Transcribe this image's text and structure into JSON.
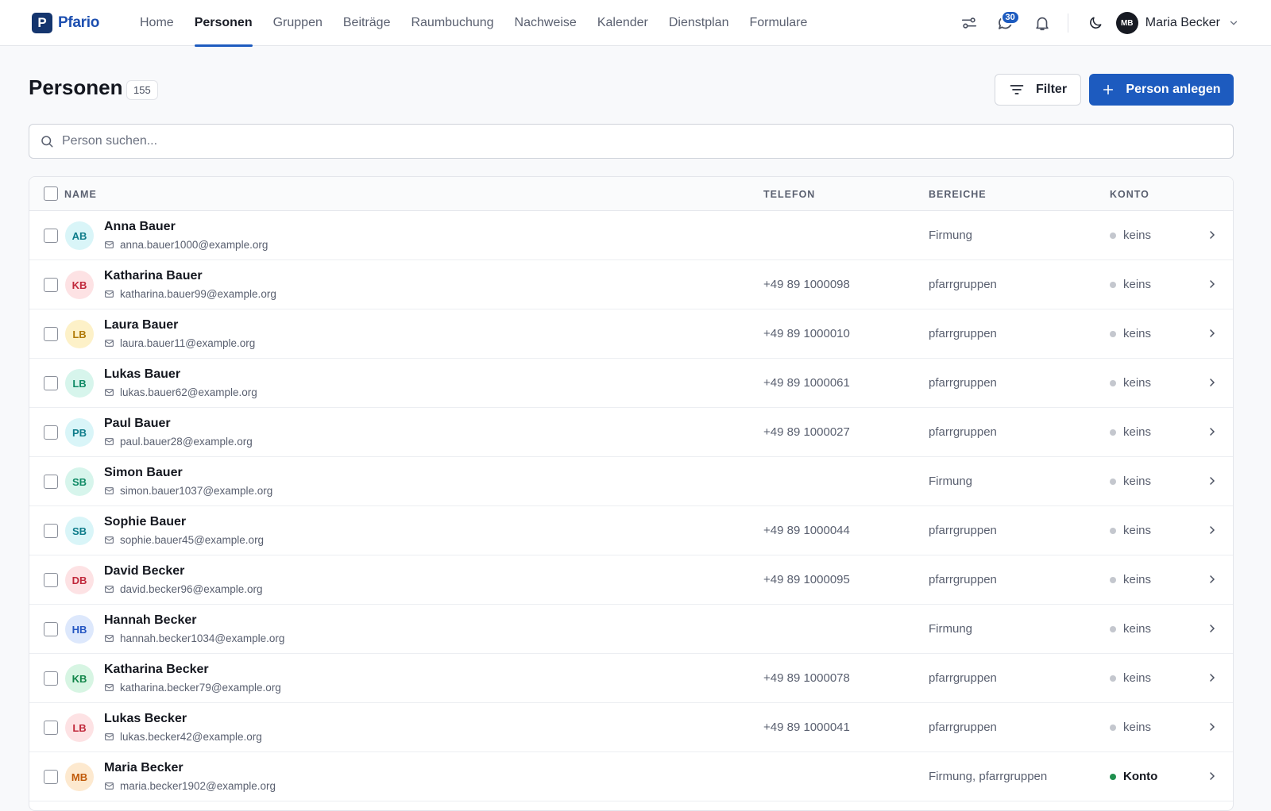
{
  "app": {
    "logo_letter": "P",
    "name": "Pfario"
  },
  "nav": [
    {
      "label": "Home",
      "active": false
    },
    {
      "label": "Personen",
      "active": true
    },
    {
      "label": "Gruppen",
      "active": false
    },
    {
      "label": "Beiträge",
      "active": false
    },
    {
      "label": "Raumbuchung",
      "active": false
    },
    {
      "label": "Nachweise",
      "active": false
    },
    {
      "label": "Kalender",
      "active": false
    },
    {
      "label": "Dienstplan",
      "active": false
    },
    {
      "label": "Formulare",
      "active": false
    }
  ],
  "topbar": {
    "messages_badge": "30",
    "user_initials": "MB",
    "user_name": "Maria Becker"
  },
  "page": {
    "title": "Personen",
    "count": "155",
    "filter_label": "Filter",
    "create_label": "Person anlegen",
    "search_placeholder": "Person suchen..."
  },
  "table": {
    "columns": {
      "name": "Name",
      "telefon": "Telefon",
      "bereiche": "Bereiche",
      "konto": "Konto"
    },
    "rows": [
      {
        "initials": "AB",
        "name": "Anna Bauer",
        "email": "anna.bauer1000@example.org",
        "phone": "",
        "bereiche": "Firmung",
        "konto": "keins",
        "has_account": false,
        "avatar_bg": "#d9f5f8",
        "avatar_fg": "#0e7c8a"
      },
      {
        "initials": "KB",
        "name": "Katharina Bauer",
        "email": "katharina.bauer99@example.org",
        "phone": "+49 89 1000098",
        "bereiche": "pfarrgruppen",
        "konto": "keins",
        "has_account": false,
        "avatar_bg": "#fde2e4",
        "avatar_fg": "#c0283b"
      },
      {
        "initials": "LB",
        "name": "Laura Bauer",
        "email": "laura.bauer11@example.org",
        "phone": "+49 89 1000010",
        "bereiche": "pfarrgruppen",
        "konto": "keins",
        "has_account": false,
        "avatar_bg": "#fdf1c8",
        "avatar_fg": "#b07a06"
      },
      {
        "initials": "LB",
        "name": "Lukas Bauer",
        "email": "lukas.bauer62@example.org",
        "phone": "+49 89 1000061",
        "bereiche": "pfarrgruppen",
        "konto": "keins",
        "has_account": false,
        "avatar_bg": "#d7f5ec",
        "avatar_fg": "#0f8a65"
      },
      {
        "initials": "PB",
        "name": "Paul Bauer",
        "email": "paul.bauer28@example.org",
        "phone": "+49 89 1000027",
        "bereiche": "pfarrgruppen",
        "konto": "keins",
        "has_account": false,
        "avatar_bg": "#d9f5f8",
        "avatar_fg": "#0e7c8a"
      },
      {
        "initials": "SB",
        "name": "Simon Bauer",
        "email": "simon.bauer1037@example.org",
        "phone": "",
        "bereiche": "Firmung",
        "konto": "keins",
        "has_account": false,
        "avatar_bg": "#d7f5ec",
        "avatar_fg": "#0f8a65"
      },
      {
        "initials": "SB",
        "name": "Sophie Bauer",
        "email": "sophie.bauer45@example.org",
        "phone": "+49 89 1000044",
        "bereiche": "pfarrgruppen",
        "konto": "keins",
        "has_account": false,
        "avatar_bg": "#d9f5f8",
        "avatar_fg": "#0e7c8a"
      },
      {
        "initials": "DB",
        "name": "David Becker",
        "email": "david.becker96@example.org",
        "phone": "+49 89 1000095",
        "bereiche": "pfarrgruppen",
        "konto": "keins",
        "has_account": false,
        "avatar_bg": "#fde2e4",
        "avatar_fg": "#c0283b"
      },
      {
        "initials": "HB",
        "name": "Hannah Becker",
        "email": "hannah.becker1034@example.org",
        "phone": "",
        "bereiche": "Firmung",
        "konto": "keins",
        "has_account": false,
        "avatar_bg": "#dde8fc",
        "avatar_fg": "#2456c2"
      },
      {
        "initials": "KB",
        "name": "Katharina Becker",
        "email": "katharina.becker79@example.org",
        "phone": "+49 89 1000078",
        "bereiche": "pfarrgruppen",
        "konto": "keins",
        "has_account": false,
        "avatar_bg": "#d7f5e3",
        "avatar_fg": "#12864a"
      },
      {
        "initials": "LB",
        "name": "Lukas Becker",
        "email": "lukas.becker42@example.org",
        "phone": "+49 89 1000041",
        "bereiche": "pfarrgruppen",
        "konto": "keins",
        "has_account": false,
        "avatar_bg": "#fde2e4",
        "avatar_fg": "#c0283b"
      },
      {
        "initials": "MB",
        "name": "Maria Becker",
        "email": "maria.becker1902@example.org",
        "phone": "",
        "bereiche": "Firmung, pfarrgruppen",
        "konto": "Konto",
        "has_account": true,
        "avatar_bg": "#fde9cf",
        "avatar_fg": "#c05a0a"
      }
    ]
  }
}
